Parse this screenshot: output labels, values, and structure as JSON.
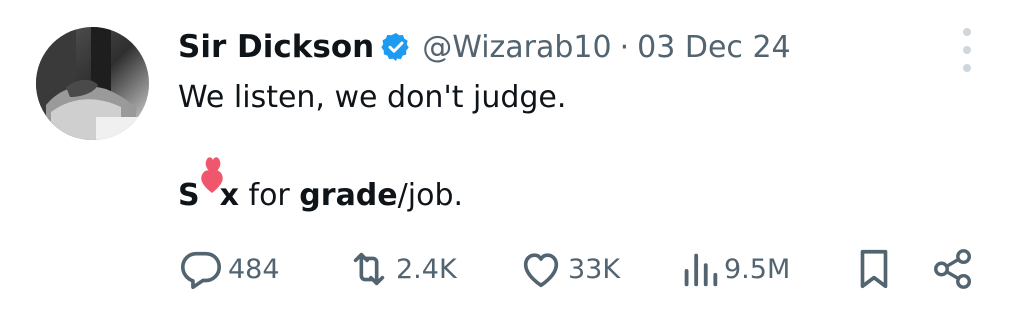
{
  "tweet": {
    "display_name": "Sir Dickson",
    "handle": "@Wizarab10",
    "separator": "·",
    "date": "03 Dec 24",
    "line1": "We listen, we don't judge.",
    "line2": {
      "part1": "S",
      "emoji": "heart-emoji",
      "part2": "x",
      "part3": " for ",
      "part4": "grade",
      "part5": "/job."
    }
  },
  "actions": {
    "replies": "484",
    "reposts": "2.4K",
    "likes": "33K",
    "views": "9.5M"
  },
  "colors": {
    "text": "#0f1419",
    "muted": "#536471",
    "verified": "#1d9bf0",
    "heart_emoji": "#f0566c"
  },
  "icons": {
    "verified": "verified-badge-icon",
    "more": "more-vertical-icon",
    "reply": "reply-icon",
    "repost": "repost-icon",
    "like": "like-heart-icon",
    "views": "views-bar-chart-icon",
    "bookmark": "bookmark-icon",
    "share": "share-icon"
  }
}
